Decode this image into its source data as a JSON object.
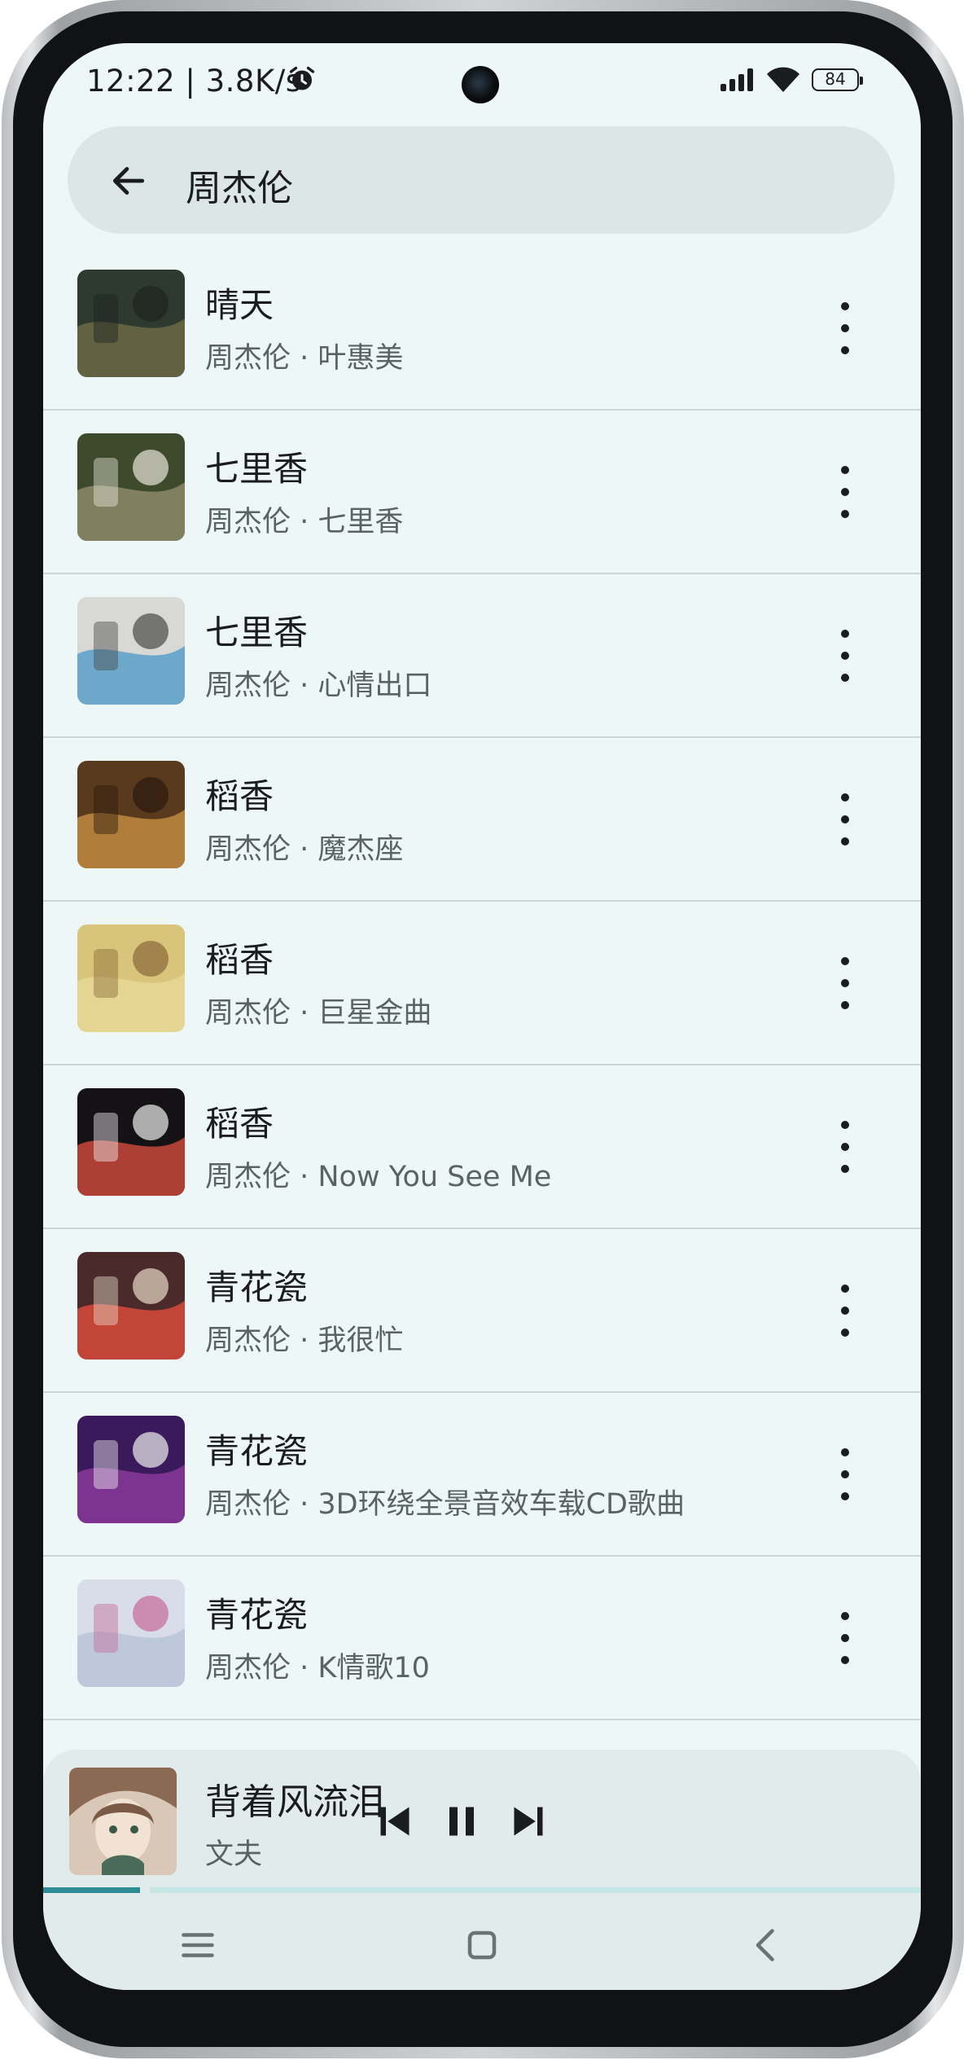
{
  "status": {
    "time": "12:22 | 3.8K/s",
    "battery": "84"
  },
  "search": {
    "query": "周杰伦"
  },
  "results": [
    {
      "title": "晴天",
      "subtitle": "周杰伦 · 叶惠美",
      "art": [
        "#2f3a2e",
        "#6b6a46",
        "#1c2420"
      ]
    },
    {
      "title": "七里香",
      "subtitle": "周杰伦 · 七里香",
      "art": [
        "#3d4a2c",
        "#8c8a6a",
        "#e8e4d8"
      ]
    },
    {
      "title": "七里香",
      "subtitle": "周杰伦 · 心情出口",
      "art": [
        "#d8d8d4",
        "#59a0c8",
        "#4a4a4a"
      ]
    },
    {
      "title": "稻香",
      "subtitle": "周杰伦 · 魔杰座",
      "art": [
        "#5a3a1c",
        "#c08a40",
        "#2a1a10"
      ]
    },
    {
      "title": "稻香",
      "subtitle": "周杰伦 · 巨星金曲",
      "art": [
        "#d8c47a",
        "#e8d898",
        "#8a6a38"
      ]
    },
    {
      "title": "稻香",
      "subtitle": "周杰伦 · Now You See Me",
      "art": [
        "#141214",
        "#c8483a",
        "#f0f0f0"
      ]
    },
    {
      "title": "青花瓷",
      "subtitle": "周杰伦 · 我很忙",
      "art": [
        "#4a2a2a",
        "#d84a3a",
        "#e8dcc8"
      ]
    },
    {
      "title": "青花瓷",
      "subtitle": "周杰伦 · 3D环绕全景音效车载CD歌曲",
      "art": [
        "#3a1a5a",
        "#8a3a9a",
        "#f0f0f0"
      ]
    },
    {
      "title": "青花瓷",
      "subtitle": "周杰伦 · K情歌10",
      "art": [
        "#d8dde8",
        "#b8c4d8",
        "#c86a9a"
      ]
    }
  ],
  "player": {
    "title": "背着风流泪",
    "artist": "文夫",
    "progress": 0.11
  },
  "icons": {
    "back": "arrow-left-icon",
    "more": "more-vert-icon",
    "prev": "skip-previous-icon",
    "pause": "pause-icon",
    "next": "skip-next-icon",
    "menu": "menu-icon",
    "home": "home-icon",
    "navback": "nav-back-icon",
    "alarm": "alarm-icon",
    "signal": "signal-icon",
    "wifi": "wifi-icon"
  }
}
